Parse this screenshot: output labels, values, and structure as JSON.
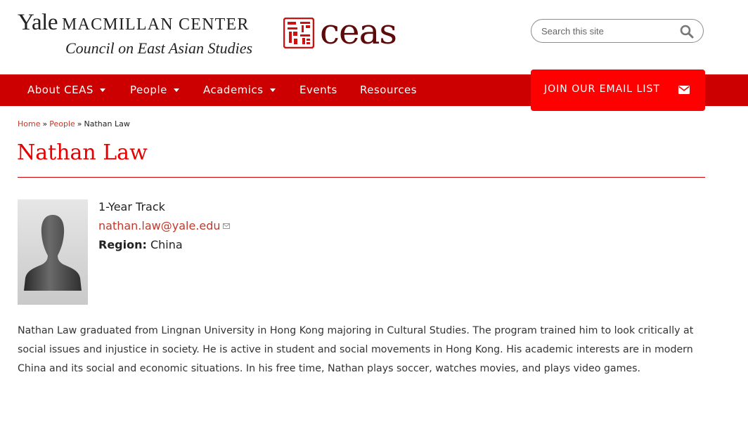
{
  "header": {
    "yale_word": "Yale",
    "center_name": "MACMILLAN CENTER",
    "council_name": "Council on East Asian Studies",
    "ceas_logo_text": "ceas",
    "seal_icon": "chinese-seal-icon",
    "search": {
      "placeholder": "Search this site",
      "icon": "search-icon"
    }
  },
  "nav": {
    "items": [
      {
        "label": "About CEAS",
        "has_dropdown": true
      },
      {
        "label": "People",
        "has_dropdown": true
      },
      {
        "label": "Academics",
        "has_dropdown": true
      },
      {
        "label": "Events",
        "has_dropdown": false
      },
      {
        "label": "Resources",
        "has_dropdown": false
      }
    ],
    "email_button": {
      "label": "JOIN OUR EMAIL LIST",
      "icon": "envelope-icon"
    }
  },
  "breadcrumb": {
    "items": [
      {
        "label": "Home"
      },
      {
        "label": "People"
      }
    ],
    "separator": "»",
    "current": "Nathan Law"
  },
  "profile": {
    "name": "Nathan Law",
    "track": "1-Year Track",
    "email": "nathan.law@yale.edu",
    "region_label": "Region:",
    "region": "China",
    "avatar_icon": "person-silhouette-icon",
    "bio": "Nathan Law graduated from Lingnan University in Hong Kong majoring in Cultural Studies. The program trained him to look critically at social issues and injustice in society. He is active in student and social movements in Hong Kong. His academic interests are in modern China and its social and economic situations. In his free time, Nathan plays soccer, watches movies, and plays video games."
  },
  "colors": {
    "nav_red": "#cc0000",
    "button_red": "#ff0000",
    "title_red": "#e60000",
    "link_red": "#c0392b",
    "ceas_maroon": "#5d0a0a"
  }
}
